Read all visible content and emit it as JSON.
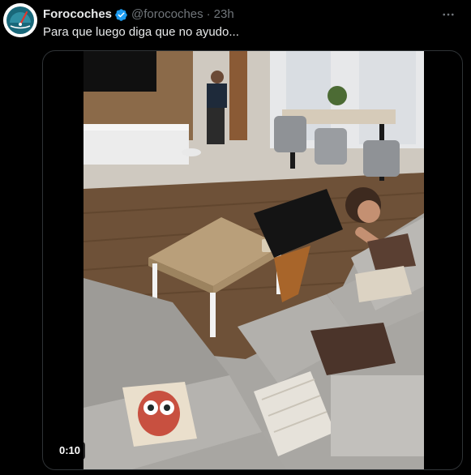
{
  "tweet": {
    "author_name": "Forocoches",
    "handle": "@forocoches",
    "separator": "·",
    "time": "23h",
    "text": "Para que luego diga que no ayudo...",
    "verified_icon": "verified-badge-icon",
    "more_icon": "more-options-icon"
  },
  "media": {
    "duration": "0:10"
  },
  "colors": {
    "background": "#000000",
    "text_primary": "#e7e9ea",
    "text_secondary": "#71767b",
    "verified": "#1d9bf0",
    "border": "#2f3336"
  }
}
